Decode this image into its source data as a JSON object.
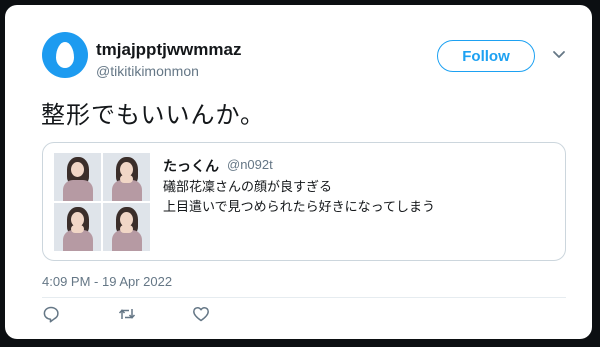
{
  "tweet": {
    "display_name": "tmjajpptjwwmmaz",
    "handle": "@tikitikimonmon",
    "follow_label": "Follow",
    "text": "整形でもいいんか。",
    "timestamp": "4:09 PM - 19 Apr 2022"
  },
  "quote": {
    "name": "たっくん",
    "handle": "@n092t",
    "line1": "礒部花凜さんの顔が良すぎる",
    "line2": "上目遣いで見つめられたら好きになってしまう"
  },
  "icons": {
    "reply": "reply-icon",
    "retweet": "retweet-icon",
    "like": "like-icon",
    "more": "chevron-down-icon",
    "avatar": "default-egg-avatar"
  },
  "colors": {
    "accent": "#1da1f2",
    "secondary_text": "#657786",
    "primary_text": "#14171a",
    "background": "#0c0f12"
  }
}
